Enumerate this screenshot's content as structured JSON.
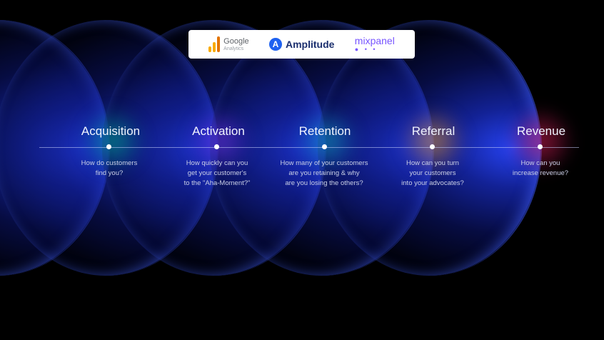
{
  "logos": {
    "google": {
      "line1": "Google",
      "line2": "Analytics"
    },
    "amplitude": {
      "icon": "A",
      "name": "Amplitude"
    },
    "mixpanel": {
      "name": "mixpanel",
      "dots": "● • •"
    }
  },
  "stages": [
    {
      "title": "Acquisition",
      "description": "How do customers\nfind you?"
    },
    {
      "title": "Activation",
      "description": "How quickly can you\nget your customer's\nto the \"Aha-Moment?\""
    },
    {
      "title": "Retention",
      "description": "How many of your customers\nare you retaining & why\nare you losing the others?"
    },
    {
      "title": "Referral",
      "description": "How can you turn\nyour customers\ninto your advocates?"
    },
    {
      "title": "Revenue",
      "description": "How can you\nincrease revenue?"
    }
  ],
  "colors": {
    "background": "#000000",
    "circle": "#2846ff",
    "glow_acquisition": "#00c8a0",
    "glow_activation": "#7a3cff",
    "glow_retention": "#18b8d8",
    "glow_referral": "#e8a040",
    "glow_revenue": "#e0205a"
  }
}
